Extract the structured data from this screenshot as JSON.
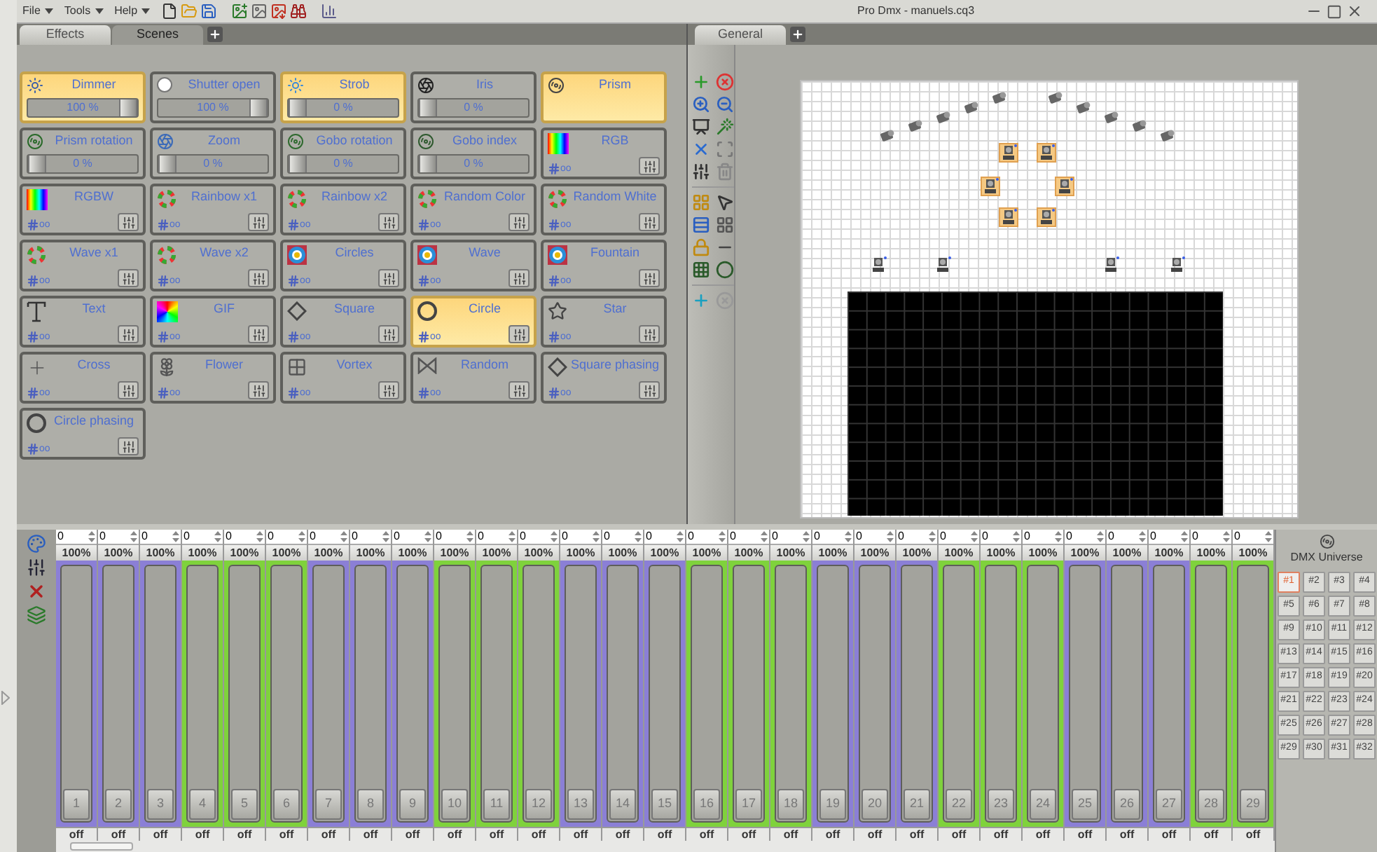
{
  "menu": [
    {
      "label": "File"
    },
    {
      "label": "Tools"
    },
    {
      "label": "Help"
    }
  ],
  "window": {
    "title": "Pro Dmx - manuels.cq3"
  },
  "left_tabs": [
    {
      "label": "Effects",
      "selected": true
    },
    {
      "label": "Scenes",
      "selected": false
    }
  ],
  "right_tabs": [
    {
      "label": "General",
      "selected": true
    }
  ],
  "effects": [
    {
      "kind": "slider",
      "title": "Dimmer",
      "active": true,
      "level": 1,
      "reading": "100 %"
    },
    {
      "kind": "slider",
      "title": "Shutter open",
      "active": false,
      "level": 1,
      "reading": "100 %"
    },
    {
      "kind": "slider",
      "title": "Strob",
      "active": true,
      "level": 0,
      "reading": "0 %"
    },
    {
      "kind": "slider",
      "title": "Iris",
      "active": false,
      "level": 0,
      "reading": "0 %"
    },
    {
      "kind": "plain",
      "title": "Prism",
      "active": true
    },
    {
      "kind": "slider",
      "title": "Prism rotation",
      "active": false,
      "level": 0,
      "reading": "0 %"
    },
    {
      "kind": "slider",
      "title": "Zoom",
      "active": false,
      "level": 0,
      "reading": "0 %"
    },
    {
      "kind": "slider",
      "title": "Gobo rotation",
      "active": false,
      "level": 0,
      "reading": "0 %"
    },
    {
      "kind": "slider",
      "title": "Gobo index",
      "active": false,
      "level": 0,
      "reading": "0 %"
    },
    {
      "kind": "pattern",
      "title": "RGB",
      "active": false,
      "count": "oo"
    },
    {
      "kind": "pattern",
      "title": "RGBW",
      "active": false,
      "count": "oo"
    },
    {
      "kind": "pattern",
      "title": "Rainbow x1",
      "active": false,
      "count": "oo"
    },
    {
      "kind": "pattern",
      "title": "Rainbow x2",
      "active": false,
      "count": "oo"
    },
    {
      "kind": "pattern",
      "title": "Random Color",
      "active": false,
      "count": "oo"
    },
    {
      "kind": "pattern",
      "title": "Random White",
      "active": false,
      "count": "oo"
    },
    {
      "kind": "pattern",
      "title": "Wave x1",
      "active": false,
      "count": "oo"
    },
    {
      "kind": "pattern",
      "title": "Wave x2",
      "active": false,
      "count": "oo"
    },
    {
      "kind": "pattern",
      "title": "Circles",
      "active": false,
      "count": "oo"
    },
    {
      "kind": "pattern",
      "title": "Wave",
      "active": false,
      "count": "oo"
    },
    {
      "kind": "pattern",
      "title": "Fountain",
      "active": false,
      "count": "oo"
    },
    {
      "kind": "pattern",
      "title": "Text",
      "active": false,
      "count": "oo"
    },
    {
      "kind": "pattern",
      "title": "GIF",
      "active": false,
      "count": "oo"
    },
    {
      "kind": "pattern",
      "title": "Square",
      "active": false,
      "count": "oo"
    },
    {
      "kind": "pattern",
      "title": "Circle",
      "active": true,
      "count": "oo"
    },
    {
      "kind": "pattern",
      "title": "Star",
      "active": false,
      "count": "oo"
    },
    {
      "kind": "pattern",
      "title": "Cross",
      "active": false,
      "count": "oo"
    },
    {
      "kind": "pattern",
      "title": "Flower",
      "active": false,
      "count": "oo"
    },
    {
      "kind": "pattern",
      "title": "Vortex",
      "active": false,
      "count": "oo"
    },
    {
      "kind": "pattern",
      "title": "Random",
      "active": false,
      "count": "oo"
    },
    {
      "kind": "pattern",
      "title": "Square phasing",
      "active": false,
      "count": "oo"
    },
    {
      "kind": "pattern",
      "title": "Circle phasing",
      "active": false,
      "count": "oo"
    }
  ],
  "fixtures": [
    {
      "kind": "scanner",
      "selected": false
    },
    {
      "kind": "scanner",
      "selected": false
    },
    {
      "kind": "scanner",
      "selected": false
    },
    {
      "kind": "scanner",
      "selected": false
    },
    {
      "kind": "scanner",
      "selected": false
    },
    {
      "kind": "scanner",
      "selected": false
    },
    {
      "kind": "scanner",
      "selected": false
    },
    {
      "kind": "scanner",
      "selected": false
    },
    {
      "kind": "scanner",
      "selected": false
    },
    {
      "kind": "scanner",
      "selected": false
    },
    {
      "kind": "moving_head",
      "selected": true
    },
    {
      "kind": "moving_head",
      "selected": true
    },
    {
      "kind": "moving_head",
      "selected": true
    },
    {
      "kind": "moving_head",
      "selected": true
    },
    {
      "kind": "moving_head",
      "selected": true
    },
    {
      "kind": "moving_head",
      "selected": true
    },
    {
      "kind": "moving_head",
      "selected": false
    },
    {
      "kind": "moving_head",
      "selected": false
    },
    {
      "kind": "moving_head",
      "selected": false
    },
    {
      "kind": "moving_head",
      "selected": false
    }
  ],
  "faders": [
    {
      "value": "0",
      "percent": "100%",
      "number": "1",
      "state": "off",
      "color": "#8b7fd6"
    },
    {
      "value": "0",
      "percent": "100%",
      "number": "2",
      "state": "off",
      "color": "#8b7fd6"
    },
    {
      "value": "0",
      "percent": "100%",
      "number": "3",
      "state": "off",
      "color": "#8b7fd6"
    },
    {
      "value": "0",
      "percent": "100%",
      "number": "4",
      "state": "off",
      "color": "#7fd23c"
    },
    {
      "value": "0",
      "percent": "100%",
      "number": "5",
      "state": "off",
      "color": "#7fd23c"
    },
    {
      "value": "0",
      "percent": "100%",
      "number": "6",
      "state": "off",
      "color": "#7fd23c"
    },
    {
      "value": "0",
      "percent": "100%",
      "number": "7",
      "state": "off",
      "color": "#8b7fd6"
    },
    {
      "value": "0",
      "percent": "100%",
      "number": "8",
      "state": "off",
      "color": "#8b7fd6"
    },
    {
      "value": "0",
      "percent": "100%",
      "number": "9",
      "state": "off",
      "color": "#8b7fd6"
    },
    {
      "value": "0",
      "percent": "100%",
      "number": "10",
      "state": "off",
      "color": "#7fd23c"
    },
    {
      "value": "0",
      "percent": "100%",
      "number": "11",
      "state": "off",
      "color": "#7fd23c"
    },
    {
      "value": "0",
      "percent": "100%",
      "number": "12",
      "state": "off",
      "color": "#7fd23c"
    },
    {
      "value": "0",
      "percent": "100%",
      "number": "13",
      "state": "off",
      "color": "#8b7fd6"
    },
    {
      "value": "0",
      "percent": "100%",
      "number": "14",
      "state": "off",
      "color": "#8b7fd6"
    },
    {
      "value": "0",
      "percent": "100%",
      "number": "15",
      "state": "off",
      "color": "#8b7fd6"
    },
    {
      "value": "0",
      "percent": "100%",
      "number": "16",
      "state": "off",
      "color": "#7fd23c"
    },
    {
      "value": "0",
      "percent": "100%",
      "number": "17",
      "state": "off",
      "color": "#7fd23c"
    },
    {
      "value": "0",
      "percent": "100%",
      "number": "18",
      "state": "off",
      "color": "#7fd23c"
    },
    {
      "value": "0",
      "percent": "100%",
      "number": "19",
      "state": "off",
      "color": "#8b7fd6"
    },
    {
      "value": "0",
      "percent": "100%",
      "number": "20",
      "state": "off",
      "color": "#8b7fd6"
    },
    {
      "value": "0",
      "percent": "100%",
      "number": "21",
      "state": "off",
      "color": "#8b7fd6"
    },
    {
      "value": "0",
      "percent": "100%",
      "number": "22",
      "state": "off",
      "color": "#7fd23c"
    },
    {
      "value": "0",
      "percent": "100%",
      "number": "23",
      "state": "off",
      "color": "#7fd23c"
    },
    {
      "value": "0",
      "percent": "100%",
      "number": "24",
      "state": "off",
      "color": "#7fd23c"
    },
    {
      "value": "0",
      "percent": "100%",
      "number": "25",
      "state": "off",
      "color": "#8b7fd6"
    },
    {
      "value": "0",
      "percent": "100%",
      "number": "26",
      "state": "off",
      "color": "#8b7fd6"
    },
    {
      "value": "0",
      "percent": "100%",
      "number": "27",
      "state": "off",
      "color": "#8b7fd6"
    },
    {
      "value": "0",
      "percent": "100%",
      "number": "28",
      "state": "off",
      "color": "#7fd23c"
    },
    {
      "value": "0",
      "percent": "100%",
      "number": "29",
      "state": "off",
      "color": "#7fd23c"
    }
  ],
  "dmx_universe": {
    "title": "DMX Universe",
    "universes": [
      {
        "label": "#1",
        "selected": true
      },
      {
        "label": "#2",
        "selected": false
      },
      {
        "label": "#3",
        "selected": false
      },
      {
        "label": "#4",
        "selected": false
      },
      {
        "label": "#5",
        "selected": false
      },
      {
        "label": "#6",
        "selected": false
      },
      {
        "label": "#7",
        "selected": false
      },
      {
        "label": "#8",
        "selected": false
      },
      {
        "label": "#9",
        "selected": false
      },
      {
        "label": "#10",
        "selected": false
      },
      {
        "label": "#11",
        "selected": false
      },
      {
        "label": "#12",
        "selected": false
      },
      {
        "label": "#13",
        "selected": false
      },
      {
        "label": "#14",
        "selected": false
      },
      {
        "label": "#15",
        "selected": false
      },
      {
        "label": "#16",
        "selected": false
      },
      {
        "label": "#17",
        "selected": false
      },
      {
        "label": "#18",
        "selected": false
      },
      {
        "label": "#19",
        "selected": false
      },
      {
        "label": "#20",
        "selected": false
      },
      {
        "label": "#21",
        "selected": false
      },
      {
        "label": "#22",
        "selected": false
      },
      {
        "label": "#23",
        "selected": false
      },
      {
        "label": "#24",
        "selected": false
      },
      {
        "label": "#25",
        "selected": false
      },
      {
        "label": "#26",
        "selected": false
      },
      {
        "label": "#27",
        "selected": false
      },
      {
        "label": "#28",
        "selected": false
      },
      {
        "label": "#29",
        "selected": false
      },
      {
        "label": "#30",
        "selected": false
      },
      {
        "label": "#31",
        "selected": false
      },
      {
        "label": "#32",
        "selected": false
      }
    ]
  }
}
